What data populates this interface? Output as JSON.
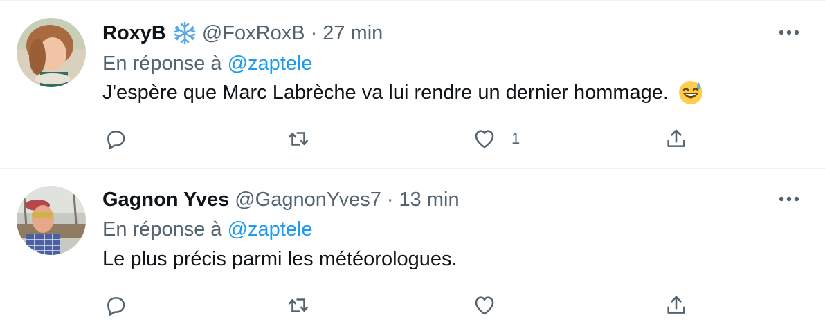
{
  "tweets": [
    {
      "name": "RoxyB",
      "name_emoji": "snowflake-icon",
      "handle": "@FoxRoxB",
      "dot": "·",
      "time": "27 min",
      "reply_prefix": "En réponse à",
      "reply_to": "@zaptele",
      "text": "J'espère que Marc Labrèche va lui rendre un dernier hommage.",
      "text_emoji": "grinning-sweat-emoji",
      "like_count": "1"
    },
    {
      "name": "Gagnon Yves",
      "handle": "@GagnonYves7",
      "dot": "·",
      "time": "13 min",
      "reply_prefix": "En réponse à",
      "reply_to": "@zaptele",
      "text": "Le plus précis parmi les météorologues."
    }
  ],
  "colors": {
    "text_primary": "#0f1419",
    "text_secondary": "#536471",
    "link": "#1d9bf0",
    "divider": "#eff3f4"
  }
}
